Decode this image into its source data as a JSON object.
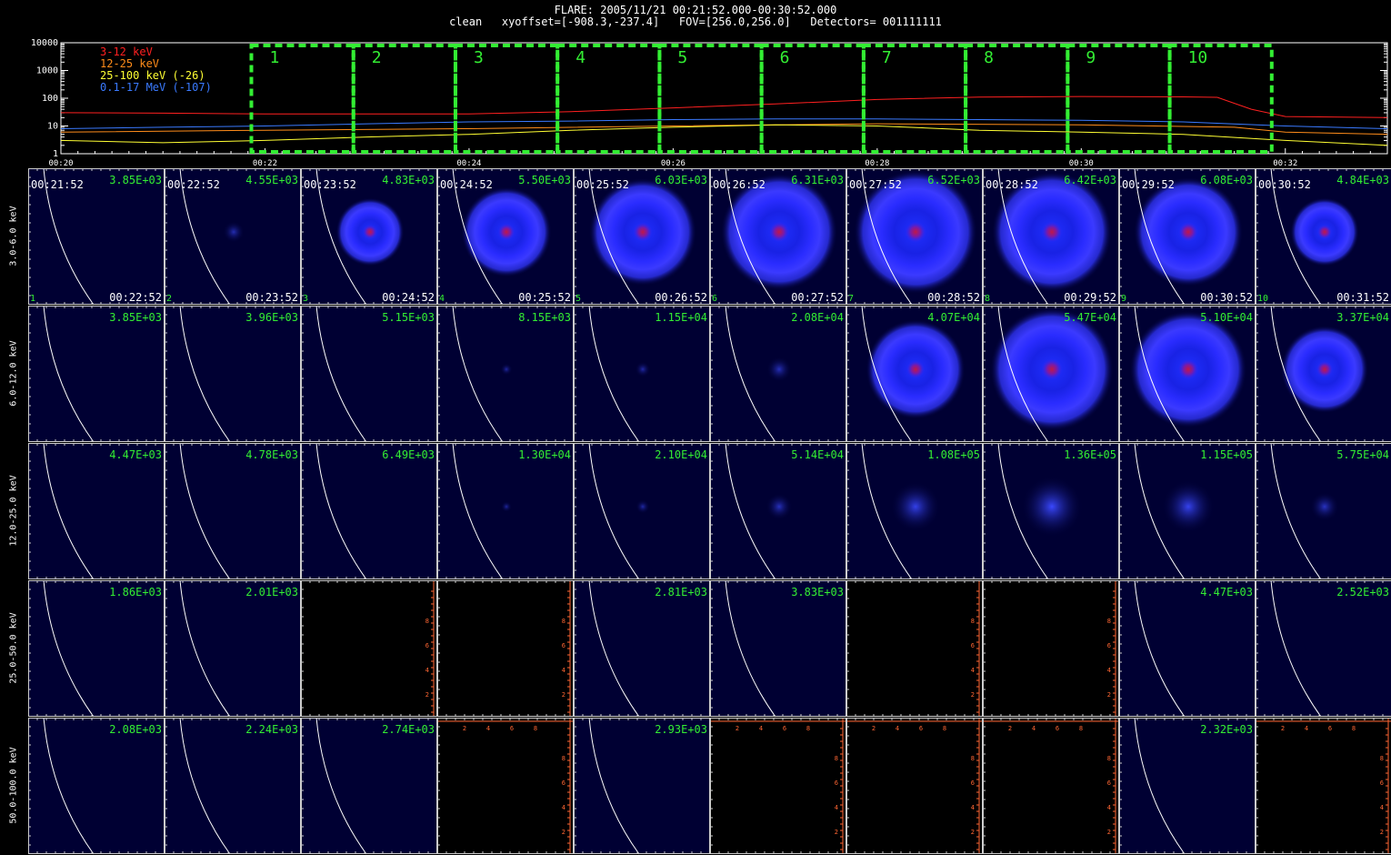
{
  "header": {
    "line1": "FLARE: 2005/11/21 00:21:52.000-00:30:52.000",
    "line2": "clean   xyoffset=[-908.3,-237.4]   FOV=[256.0,256.0]   Detectors= 001111111"
  },
  "chart_data": [
    {
      "type": "line",
      "name": "lightcurve",
      "yscale": "log",
      "ylim": [
        1,
        10000
      ],
      "ytick_labels": [
        "1",
        "10",
        "100",
        "1000",
        "10000"
      ],
      "xlim": [
        "00:20",
        "00:33"
      ],
      "xtick_labels": [
        "00:20",
        "00:22",
        "00:24",
        "00:26",
        "00:28",
        "00:30",
        "00:32"
      ],
      "series": [
        {
          "name": "3-12 keV",
          "color": "#ff2020",
          "x": [
            "00:20",
            "00:21",
            "00:22",
            "00:23",
            "00:24",
            "00:25",
            "00:26",
            "00:27",
            "00:28",
            "00:29",
            "00:30",
            "00:31",
            "00:31:20",
            "00:31:40",
            "00:32",
            "00:33"
          ],
          "y": [
            30,
            29,
            27,
            27,
            27,
            33,
            45,
            62,
            90,
            110,
            115,
            112,
            108,
            40,
            22,
            20
          ]
        },
        {
          "name": "12-25 keV",
          "color": "#ff8c1a",
          "x": [
            "00:20",
            "00:22",
            "00:24",
            "00:26",
            "00:28",
            "00:30",
            "00:31:30",
            "00:32",
            "00:33"
          ],
          "y": [
            6,
            7,
            8,
            10,
            12,
            11,
            9,
            6,
            5
          ]
        },
        {
          "name": "25-100 keV (-26)",
          "color": "#ffff33",
          "x": [
            "00:20",
            "00:21",
            "00:22",
            "00:23",
            "00:24",
            "00:25",
            "00:26",
            "00:27",
            "00:28",
            "00:29",
            "00:30",
            "00:31",
            "00:32",
            "00:33"
          ],
          "y": [
            3,
            2.5,
            3,
            4,
            5,
            7,
            9,
            11,
            10,
            7,
            6,
            5,
            3,
            2
          ]
        },
        {
          "name": "0.1-17 MeV (-107)",
          "color": "#3a7aff",
          "x": [
            "00:20",
            "00:21",
            "00:22",
            "00:23",
            "00:24",
            "00:25",
            "00:26",
            "00:27",
            "00:28",
            "00:29",
            "00:30",
            "00:31",
            "00:32",
            "00:33"
          ],
          "y": [
            8,
            9,
            10,
            12,
            14,
            15,
            17,
            18,
            18,
            17,
            16,
            14,
            10,
            8
          ]
        }
      ],
      "intervals": [
        {
          "label": "1",
          "start": "00:21:52",
          "end": "00:22:52"
        },
        {
          "label": "2",
          "start": "00:22:52",
          "end": "00:23:52"
        },
        {
          "label": "3",
          "start": "00:23:52",
          "end": "00:24:52"
        },
        {
          "label": "4",
          "start": "00:24:52",
          "end": "00:25:52"
        },
        {
          "label": "5",
          "start": "00:25:52",
          "end": "00:26:52"
        },
        {
          "label": "6",
          "start": "00:26:52",
          "end": "00:27:52"
        },
        {
          "label": "7",
          "start": "00:27:52",
          "end": "00:28:52"
        },
        {
          "label": "8",
          "start": "00:28:52",
          "end": "00:29:52"
        },
        {
          "label": "9",
          "start": "00:29:52",
          "end": "00:30:52"
        },
        {
          "label": "10",
          "start": "00:30:52",
          "end": "00:31:52"
        }
      ],
      "interval_color": "#33ee33"
    },
    {
      "type": "heatmap",
      "name": "image_grid",
      "rows": [
        "3.0-6.0 keV",
        "6.0-12.0 keV",
        "12.0-25.0 keV",
        "25.0-50.0 keV",
        "50.0-100.0 keV"
      ],
      "start_times": [
        "00:21:52",
        "00:22:52",
        "00:23:52",
        "00:24:52",
        "00:25:52",
        "00:26:52",
        "00:27:52",
        "00:28:52",
        "00:29:52",
        "00:30:52"
      ],
      "end_times": [
        "00:22:52",
        "00:23:52",
        "00:24:52",
        "00:25:52",
        "00:26:52",
        "00:27:52",
        "00:28:52",
        "00:29:52",
        "00:30:52",
        "00:31:52"
      ],
      "max_values": [
        [
          "3.85E+03",
          "4.55E+03",
          "4.83E+03",
          "5.50E+03",
          "6.03E+03",
          "6.31E+03",
          "6.52E+03",
          "6.42E+03",
          "6.08E+03",
          "4.84E+03"
        ],
        [
          "3.85E+03",
          "3.96E+03",
          "5.15E+03",
          "8.15E+03",
          "1.15E+04",
          "2.08E+04",
          "4.07E+04",
          "5.47E+04",
          "5.10E+04",
          "3.37E+04"
        ],
        [
          "4.47E+03",
          "4.78E+03",
          "6.49E+03",
          "1.30E+04",
          "2.10E+04",
          "5.14E+04",
          "1.08E+05",
          "1.36E+05",
          "1.15E+05",
          "5.75E+04"
        ],
        [
          "1.86E+03",
          "2.01E+03",
          "",
          "",
          "2.81E+03",
          "3.83E+03",
          "",
          "",
          "4.47E+03",
          "2.52E+03"
        ],
        [
          "2.08E+03",
          "2.24E+03",
          "2.74E+03",
          "",
          "2.93E+03",
          "",
          "",
          "",
          "2.32E+03",
          ""
        ]
      ],
      "empty_tick_labels": [
        "2",
        "4",
        "6",
        "8"
      ],
      "colors": {
        "background": "#000033",
        "value_text": "#33ee33",
        "empty_axis": "#ff6633",
        "limb": "#ffffff"
      }
    }
  ]
}
